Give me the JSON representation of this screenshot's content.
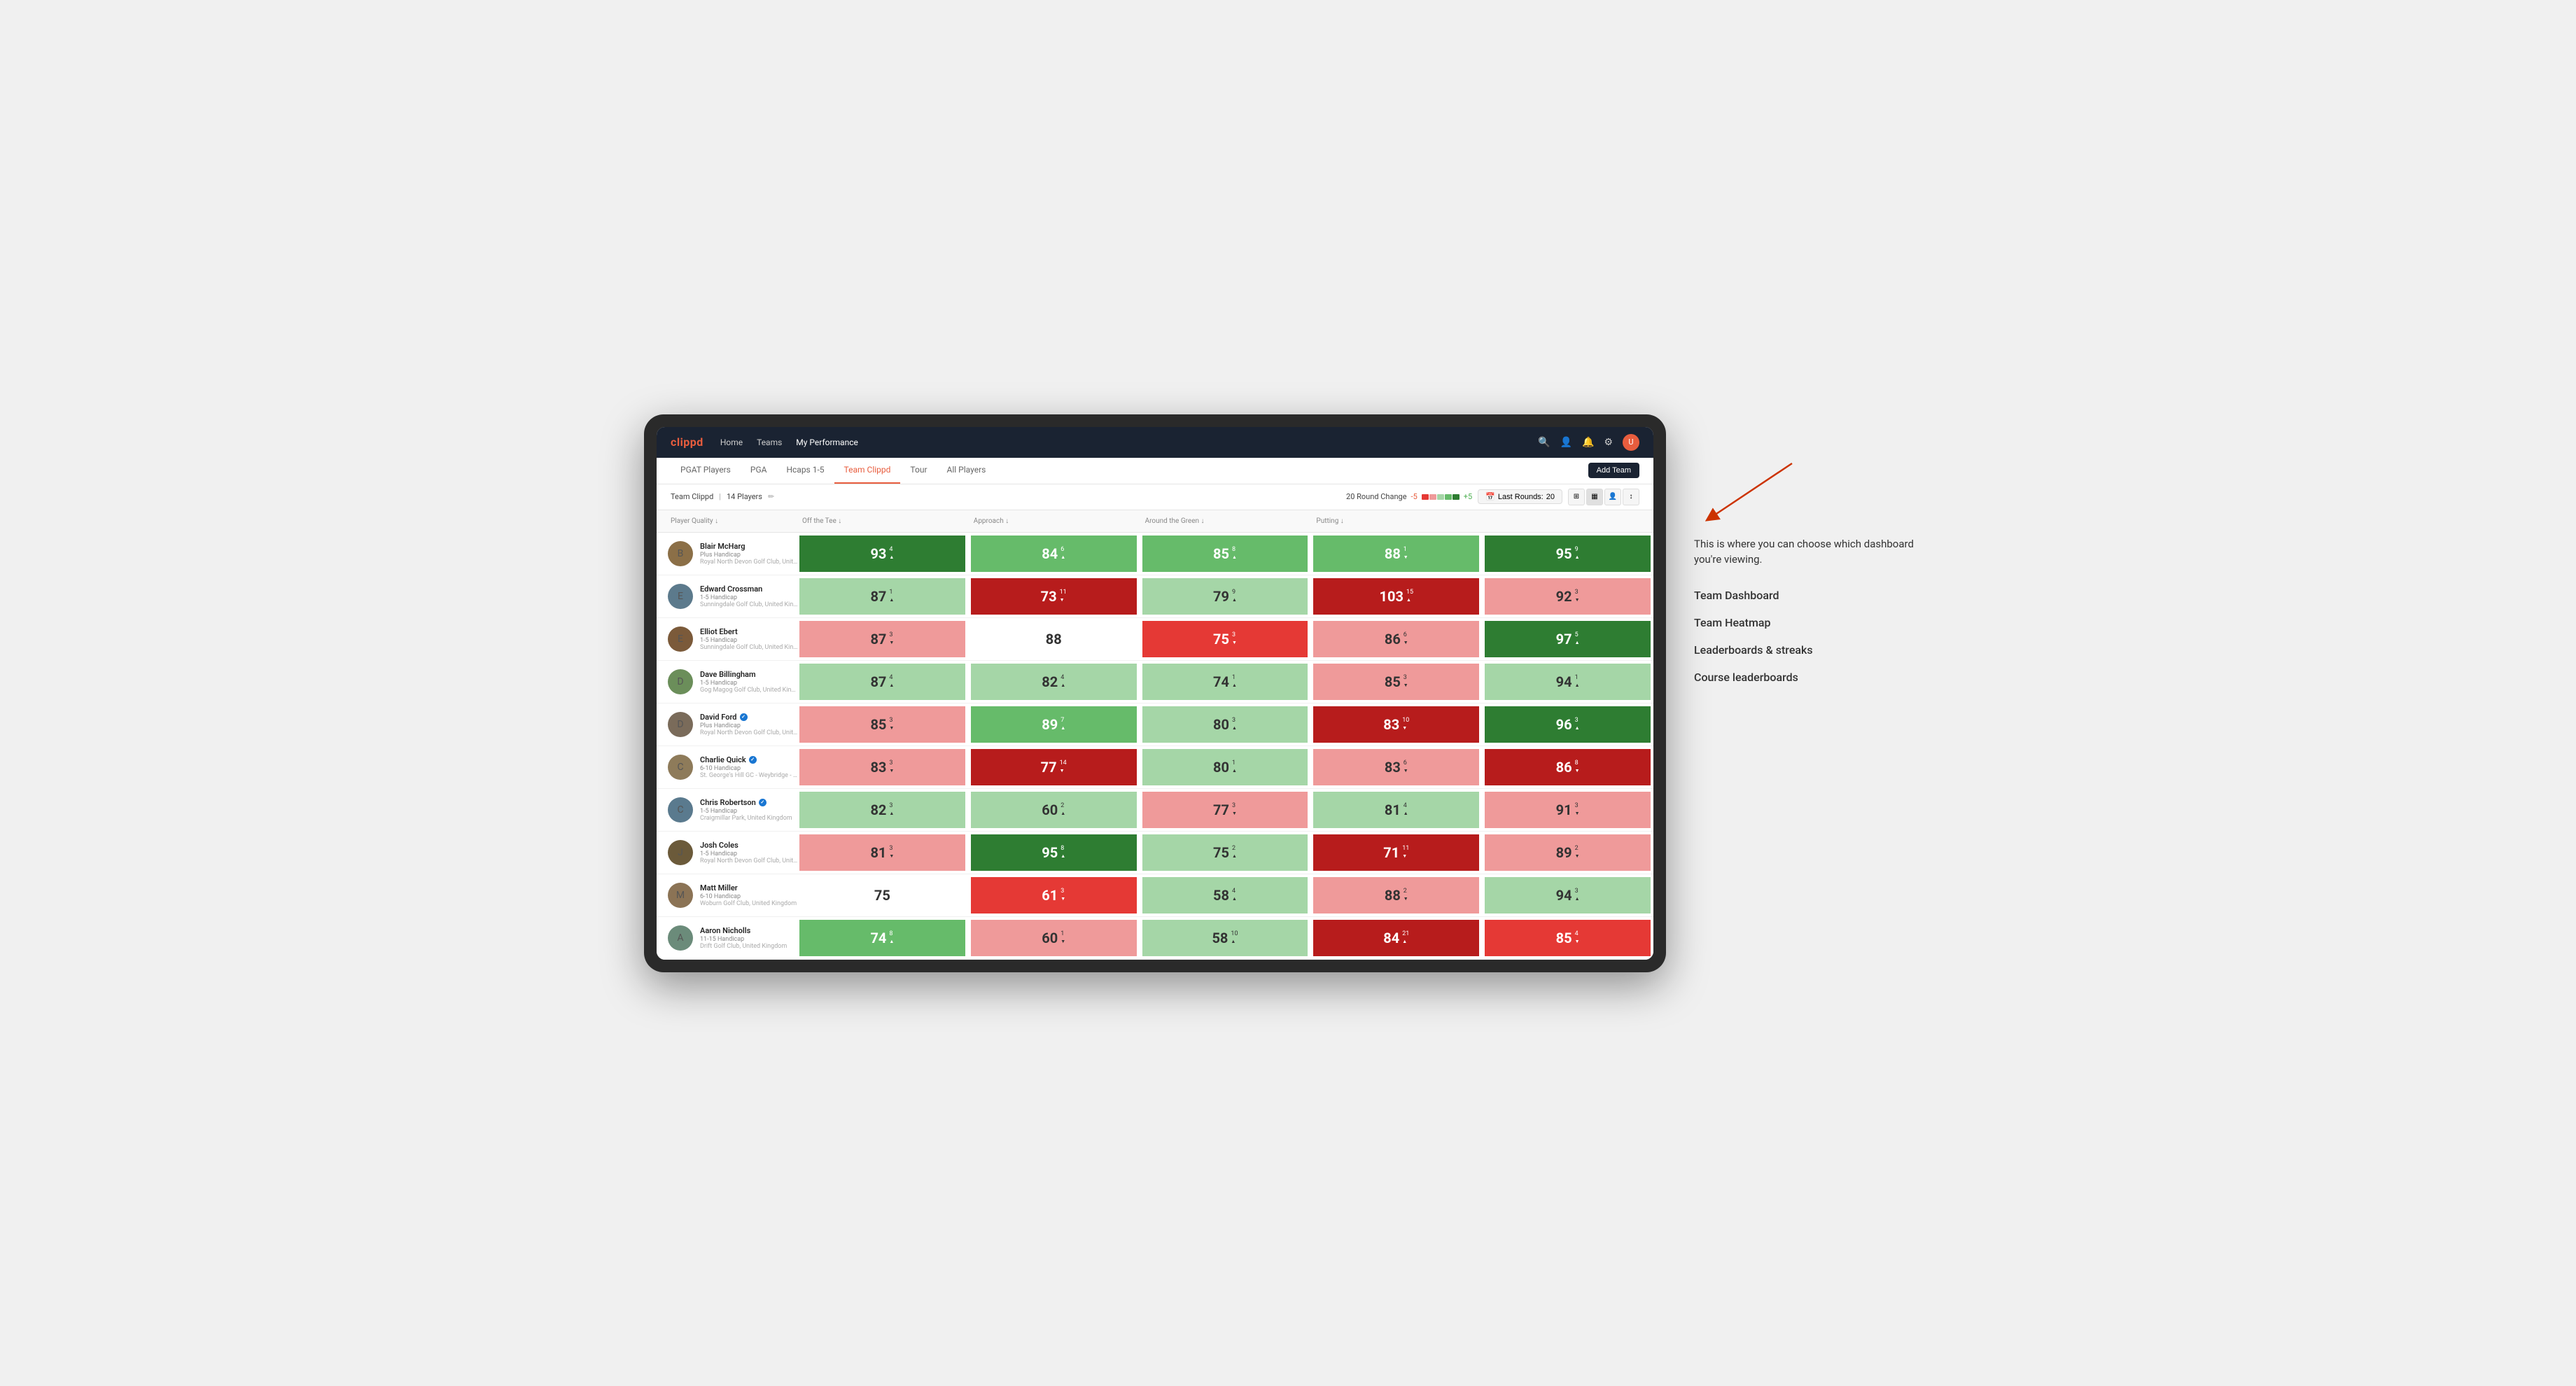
{
  "app": {
    "logo": "clippd",
    "nav_links": [
      "Home",
      "Teams",
      "My Performance"
    ],
    "sub_nav": [
      "PGAT Players",
      "PGA",
      "Hcaps 1-5",
      "Team Clippd",
      "Tour",
      "All Players"
    ],
    "active_sub_nav": "Team Clippd",
    "add_team_label": "Add Team"
  },
  "team_bar": {
    "team_name": "Team Clippd",
    "player_count": "14 Players",
    "round_change_label": "20 Round Change",
    "range_neg": "-5",
    "range_pos": "+5",
    "last_rounds_label": "Last Rounds:",
    "last_rounds_value": "20"
  },
  "table": {
    "columns": [
      "Player Quality ↓",
      "Off the Tee ↓",
      "Approach ↓",
      "Around the Green ↓",
      "Putting ↓"
    ],
    "players": [
      {
        "name": "Blair McHarg",
        "handicap": "Plus Handicap",
        "club": "Royal North Devon Golf Club, United Kingdom",
        "avatar_bg": "#8B6F47",
        "scores": [
          {
            "value": 93,
            "delta": 4,
            "dir": "up",
            "color": "green-strong"
          },
          {
            "value": 84,
            "delta": 6,
            "dir": "up",
            "color": "green-med"
          },
          {
            "value": 85,
            "delta": 8,
            "dir": "up",
            "color": "green-med"
          },
          {
            "value": 88,
            "delta": 1,
            "dir": "down",
            "color": "green-med"
          },
          {
            "value": 95,
            "delta": 9,
            "dir": "up",
            "color": "green-strong"
          }
        ]
      },
      {
        "name": "Edward Crossman",
        "handicap": "1-5 Handicap",
        "club": "Sunningdale Golf Club, United Kingdom",
        "avatar_bg": "#5C7A8C",
        "scores": [
          {
            "value": 87,
            "delta": 1,
            "dir": "up",
            "color": "green-light"
          },
          {
            "value": 73,
            "delta": 11,
            "dir": "down",
            "color": "red-strong"
          },
          {
            "value": 79,
            "delta": 9,
            "dir": "up",
            "color": "green-light"
          },
          {
            "value": 103,
            "delta": 15,
            "dir": "up",
            "color": "red-strong"
          },
          {
            "value": 92,
            "delta": 3,
            "dir": "down",
            "color": "red-light"
          }
        ]
      },
      {
        "name": "Elliot Ebert",
        "handicap": "1-5 Handicap",
        "club": "Sunningdale Golf Club, United Kingdom",
        "avatar_bg": "#7B5A3A",
        "scores": [
          {
            "value": 87,
            "delta": 3,
            "dir": "down",
            "color": "red-light"
          },
          {
            "value": 88,
            "delta": null,
            "dir": null,
            "color": "white"
          },
          {
            "value": 75,
            "delta": 3,
            "dir": "down",
            "color": "red-med"
          },
          {
            "value": 86,
            "delta": 6,
            "dir": "down",
            "color": "red-light"
          },
          {
            "value": 97,
            "delta": 5,
            "dir": "up",
            "color": "green-strong"
          }
        ]
      },
      {
        "name": "Dave Billingham",
        "handicap": "1-5 Handicap",
        "club": "Gog Magog Golf Club, United Kingdom",
        "avatar_bg": "#6B8E5A",
        "scores": [
          {
            "value": 87,
            "delta": 4,
            "dir": "up",
            "color": "green-light"
          },
          {
            "value": 82,
            "delta": 4,
            "dir": "up",
            "color": "green-light"
          },
          {
            "value": 74,
            "delta": 1,
            "dir": "up",
            "color": "green-light"
          },
          {
            "value": 85,
            "delta": 3,
            "dir": "down",
            "color": "red-light"
          },
          {
            "value": 94,
            "delta": 1,
            "dir": "up",
            "color": "green-light"
          }
        ]
      },
      {
        "name": "David Ford",
        "handicap": "Plus Handicap",
        "club": "Royal North Devon Golf Club, United Kingdom",
        "avatar_bg": "#7A6B5A",
        "verified": true,
        "scores": [
          {
            "value": 85,
            "delta": 3,
            "dir": "down",
            "color": "red-light"
          },
          {
            "value": 89,
            "delta": 7,
            "dir": "up",
            "color": "green-med"
          },
          {
            "value": 80,
            "delta": 3,
            "dir": "up",
            "color": "green-light"
          },
          {
            "value": 83,
            "delta": 10,
            "dir": "down",
            "color": "red-strong"
          },
          {
            "value": 96,
            "delta": 3,
            "dir": "up",
            "color": "green-strong"
          }
        ]
      },
      {
        "name": "Charlie Quick",
        "handicap": "6-10 Handicap",
        "club": "St. George's Hill GC - Weybridge - Surrey, Uni...",
        "avatar_bg": "#8E7B5A",
        "verified": true,
        "scores": [
          {
            "value": 83,
            "delta": 3,
            "dir": "down",
            "color": "red-light"
          },
          {
            "value": 77,
            "delta": 14,
            "dir": "down",
            "color": "red-strong"
          },
          {
            "value": 80,
            "delta": 1,
            "dir": "up",
            "color": "green-light"
          },
          {
            "value": 83,
            "delta": 6,
            "dir": "down",
            "color": "red-light"
          },
          {
            "value": 86,
            "delta": 8,
            "dir": "down",
            "color": "red-strong"
          }
        ]
      },
      {
        "name": "Chris Robertson",
        "handicap": "1-5 Handicap",
        "club": "Craigmillar Park, United Kingdom",
        "avatar_bg": "#5A7A8E",
        "verified": true,
        "scores": [
          {
            "value": 82,
            "delta": 3,
            "dir": "up",
            "color": "green-light"
          },
          {
            "value": 60,
            "delta": 2,
            "dir": "up",
            "color": "green-light"
          },
          {
            "value": 77,
            "delta": 3,
            "dir": "down",
            "color": "red-light"
          },
          {
            "value": 81,
            "delta": 4,
            "dir": "up",
            "color": "green-light"
          },
          {
            "value": 91,
            "delta": 3,
            "dir": "down",
            "color": "red-light"
          }
        ]
      },
      {
        "name": "Josh Coles",
        "handicap": "1-5 Handicap",
        "club": "Royal North Devon Golf Club, United Kingdom",
        "avatar_bg": "#6B5A3A",
        "scores": [
          {
            "value": 81,
            "delta": 3,
            "dir": "down",
            "color": "red-light"
          },
          {
            "value": 95,
            "delta": 8,
            "dir": "up",
            "color": "green-strong"
          },
          {
            "value": 75,
            "delta": 2,
            "dir": "up",
            "color": "green-light"
          },
          {
            "value": 71,
            "delta": 11,
            "dir": "down",
            "color": "red-strong"
          },
          {
            "value": 89,
            "delta": 2,
            "dir": "down",
            "color": "red-light"
          }
        ]
      },
      {
        "name": "Matt Miller",
        "handicap": "6-10 Handicap",
        "club": "Woburn Golf Club, United Kingdom",
        "avatar_bg": "#8B7355",
        "scores": [
          {
            "value": 75,
            "delta": null,
            "dir": null,
            "color": "white"
          },
          {
            "value": 61,
            "delta": 3,
            "dir": "down",
            "color": "red-med"
          },
          {
            "value": 58,
            "delta": 4,
            "dir": "up",
            "color": "green-light"
          },
          {
            "value": 88,
            "delta": 2,
            "dir": "down",
            "color": "red-light"
          },
          {
            "value": 94,
            "delta": 3,
            "dir": "up",
            "color": "green-light"
          }
        ]
      },
      {
        "name": "Aaron Nicholls",
        "handicap": "11-15 Handicap",
        "club": "Drift Golf Club, United Kingdom",
        "avatar_bg": "#6B8B7A",
        "scores": [
          {
            "value": 74,
            "delta": 8,
            "dir": "up",
            "color": "green-med"
          },
          {
            "value": 60,
            "delta": 1,
            "dir": "down",
            "color": "red-light"
          },
          {
            "value": 58,
            "delta": 10,
            "dir": "up",
            "color": "green-light"
          },
          {
            "value": 84,
            "delta": 21,
            "dir": "up",
            "color": "red-strong"
          },
          {
            "value": 85,
            "delta": 4,
            "dir": "down",
            "color": "red-med"
          }
        ]
      }
    ]
  },
  "annotation": {
    "text": "This is where you can choose which dashboard you're viewing.",
    "menu_items": [
      "Team Dashboard",
      "Team Heatmap",
      "Leaderboards & streaks",
      "Course leaderboards"
    ]
  }
}
